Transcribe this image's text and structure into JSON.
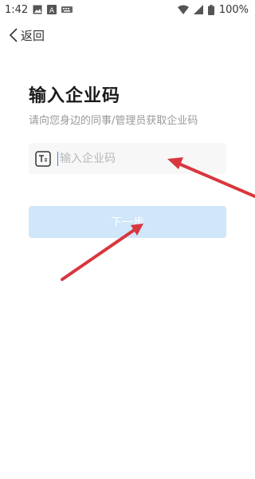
{
  "status_bar": {
    "time": "1:42",
    "battery": "100%",
    "icons": [
      "image-icon",
      "text-a-icon",
      "keyboard-icon",
      "wifi-icon",
      "signal-icon",
      "battery-icon"
    ]
  },
  "nav": {
    "back_label": "返回"
  },
  "main": {
    "title": "输入企业码",
    "subtitle": "请向您身边的同事/管理员获取企业码",
    "input": {
      "placeholder": "输入企业码",
      "value": ""
    },
    "next_label": "下一步"
  },
  "colors": {
    "button_bg": "#cfe6fb",
    "input_bg": "#f7f7f7",
    "annotation_arrow": "#d9363e"
  }
}
